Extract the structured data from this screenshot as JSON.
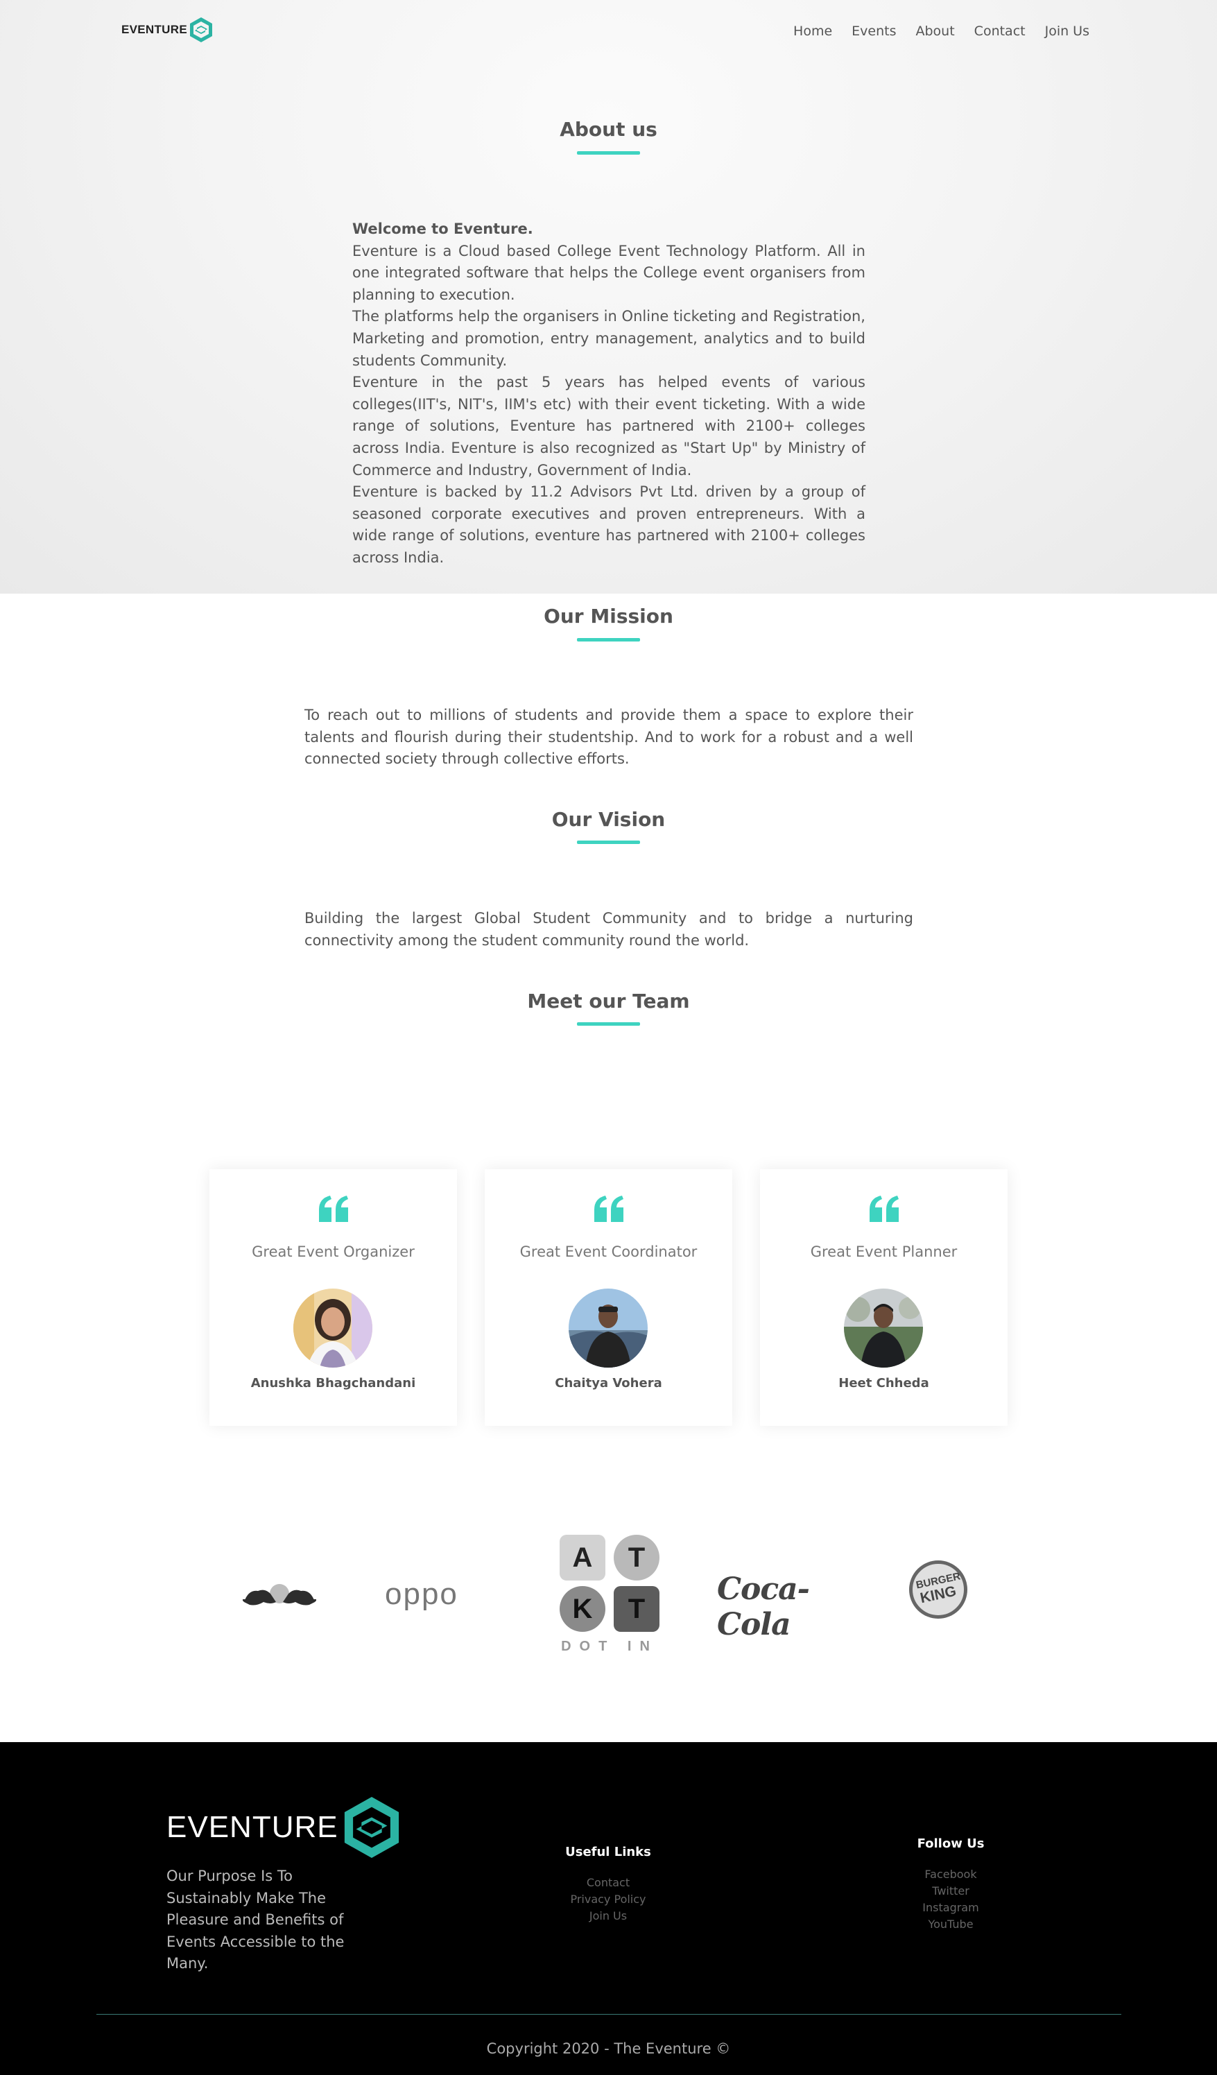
{
  "nav": {
    "logo_text": "EVENTURE",
    "links": [
      "Home",
      "Events",
      "About",
      "Contact",
      "Join Us"
    ]
  },
  "about": {
    "title": "About us",
    "welcome": "Welcome to Eventure.",
    "paragraphs": [
      "Eventure is a Cloud based College Event Technology Platform. All in one integrated software that helps the College event organisers from planning to execution.",
      "The platforms help the organisers in Online ticketing and Registration, Marketing and promotion, entry management, analytics and to build students Community.",
      "Eventure in the past 5 years has helped events of various colleges(IIT's, NIT's, IIM's etc) with their event ticketing. With a wide range of solutions, Eventure has partnered with 2100+ colleges across India. Eventure is also recognized as \"Start Up\" by Ministry of Commerce and Industry, Government of India.",
      "Eventure is backed by 11.2 Advisors Pvt Ltd. driven by a group of seasoned corporate executives and proven entrepreneurs. With a wide range of solutions, eventure has partnered with 2100+ colleges across India."
    ]
  },
  "mission": {
    "title": "Our Mission",
    "text": "To reach out to millions of students and provide them a space to explore their talents and flourish during their studentship. And to work for a robust and a well connected society through collective efforts."
  },
  "vision": {
    "title": "Our Vision",
    "text": "Building the largest Global Student Community and to bridge a nurturing connectivity among the student community round the world."
  },
  "team": {
    "title": "Meet our Team",
    "members": [
      {
        "role": "Great Event Organizer",
        "name": "Anushka Bhagchandani"
      },
      {
        "role": "Great Event Coordinator",
        "name": "Chaitya Vohera"
      },
      {
        "role": "Great Event Planner",
        "name": "Heet Chheda"
      }
    ]
  },
  "sponsors": {
    "logos": [
      "red-bull-logo",
      "oppo-logo",
      "atkt-dot-in-logo",
      "coca-cola-logo",
      "burger-king-logo"
    ],
    "oppo_text": "oppo",
    "atkt_tiles": [
      "A",
      "T",
      "K",
      "T"
    ],
    "atkt_caption": "DOT IN",
    "cocacola_text": "Coca-Cola",
    "bk_text_1": "BURGER",
    "bk_text_2": "KING"
  },
  "footer": {
    "brand": "EVENTURE",
    "purpose": "Our Purpose Is To Sustainably Make The Pleasure and Benefits of Events Accessible to the Many.",
    "useful_links_title": "Useful Links",
    "useful_links": [
      "Contact",
      "Privacy Policy",
      "Join Us"
    ],
    "follow_title": "Follow Us",
    "follow_links": [
      "Facebook",
      "Twitter",
      "Instagram",
      "YouTube"
    ],
    "copyright": "Copyright 2020 - The Eventure ©"
  },
  "colors": {
    "accent": "#3ed3c0",
    "footer_bg": "#000000",
    "text": "#555555"
  }
}
